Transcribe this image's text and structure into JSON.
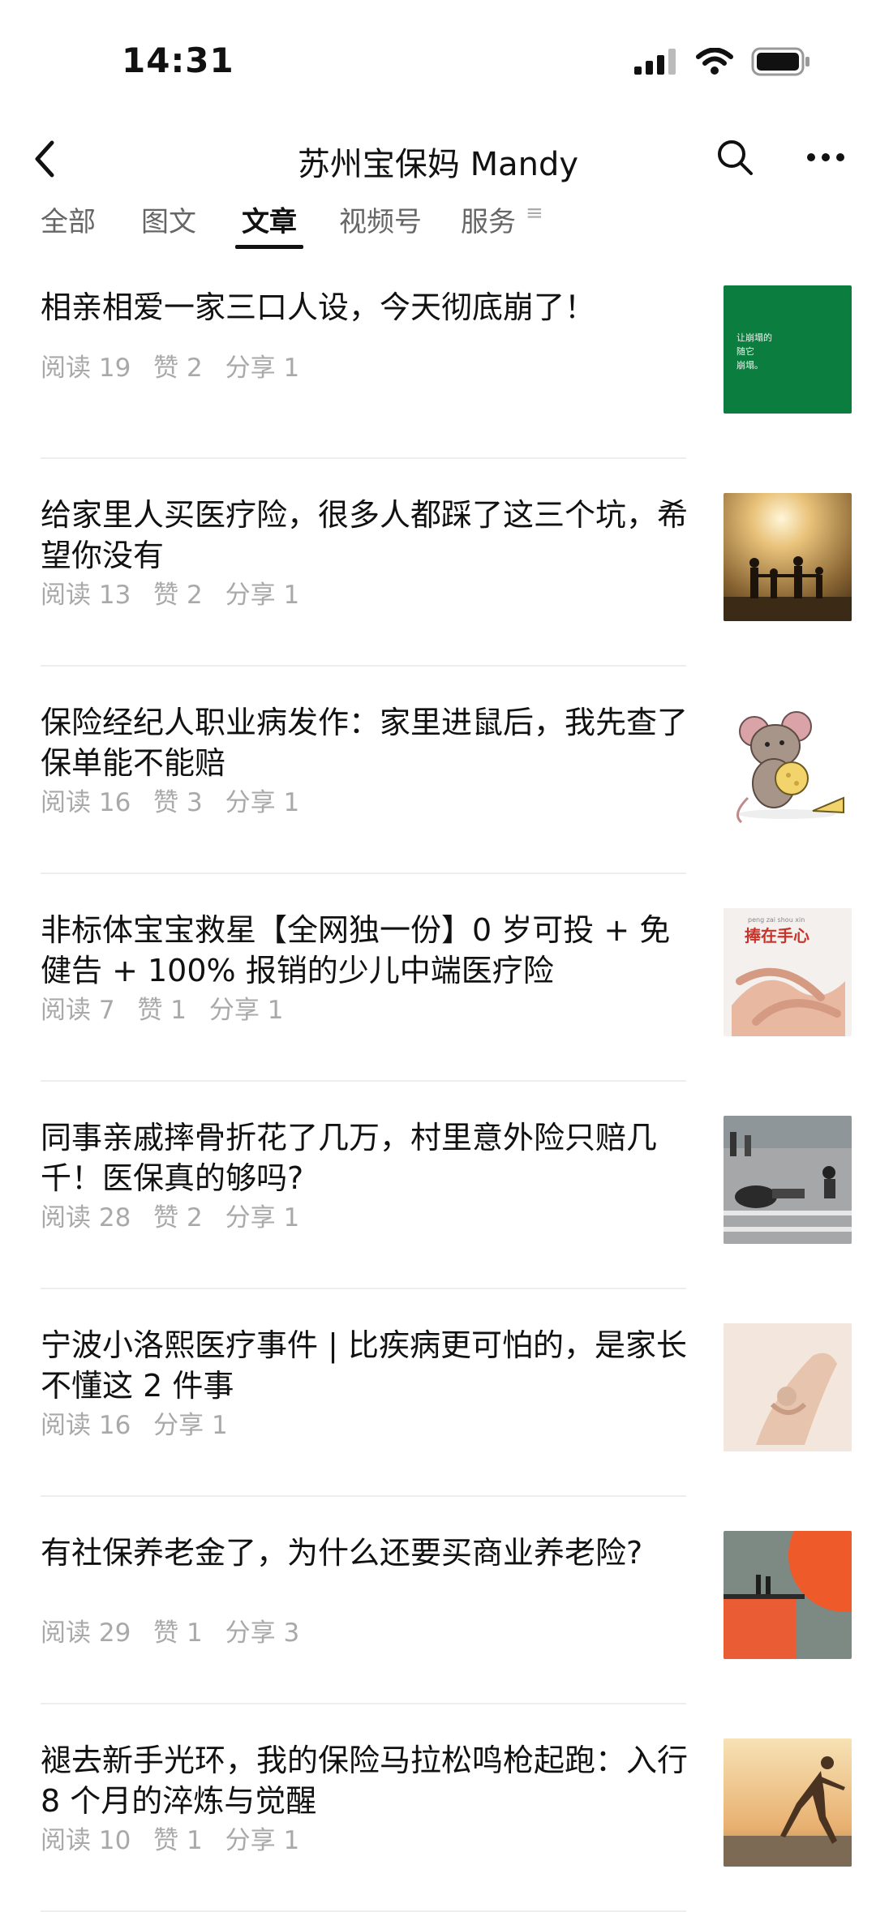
{
  "status_bar": {
    "time": "14:31"
  },
  "header": {
    "title": "苏州宝保妈 Mandy"
  },
  "tabs": [
    {
      "label": "全部"
    },
    {
      "label": "图文"
    },
    {
      "label": "文章"
    },
    {
      "label": "视频号"
    },
    {
      "label": "服务"
    }
  ],
  "active_tab": "文章",
  "articles": [
    {
      "title": "相亲相爱一家三口人设，今天彻底崩了！",
      "reads": "阅读 19",
      "likes": "赞 2",
      "shares": "分享 1",
      "thumb_text": "让崩塌的\n随它\n崩塌。"
    },
    {
      "title": "给家里人买医疗险，很多人都踩了这三个坑，希望你没有",
      "reads": "阅读 13",
      "likes": "赞 2",
      "shares": "分享 1"
    },
    {
      "title": "保险经纪人职业病发作：家里进鼠后，我先查了保单能不能赔",
      "reads": "阅读 16",
      "likes": "赞 3",
      "shares": "分享 1"
    },
    {
      "title": "非标体宝宝救星【全网独一份】0 岁可投 + 免健告 + 100% 报销的少儿中端医疗险",
      "reads": "阅读 7",
      "likes": "赞 1",
      "shares": "分享 1",
      "thumb_text": "捧在手心",
      "thumb_pinyin": "peng zai shou xin"
    },
    {
      "title": "同事亲戚摔骨折花了几万，村里意外险只赔几千！医保真的够吗?",
      "reads": "阅读 28",
      "likes": "赞 2",
      "shares": "分享 1"
    },
    {
      "title": "宁波小洛熙医疗事件 | 比疾病更可怕的，是家长不懂这 2 件事",
      "reads": "阅读 16",
      "likes": "",
      "shares": "分享 1"
    },
    {
      "title": "有社保养老金了，为什么还要买商业养老险?",
      "reads": "阅读 29",
      "likes": "赞 1",
      "shares": "分享 3"
    },
    {
      "title": "褪去新手光环，我的保险马拉松鸣枪起跑：入行 8 个月的淬炼与觉醒",
      "reads": "阅读 10",
      "likes": "赞 1",
      "shares": "分享 1"
    }
  ],
  "colors": {
    "accent": "#111111",
    "meta": "#a9a9a9",
    "divider": "#eeeeee"
  }
}
